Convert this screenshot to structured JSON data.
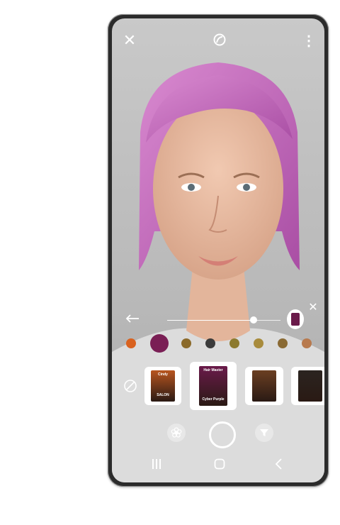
{
  "top_bar": {
    "close_icon": "close-icon",
    "logo_icon": "brand-logo-icon",
    "more_icon": "more-vertical-icon"
  },
  "slider": {
    "intensity": 0.76,
    "back_icon": "arrow-left-icon",
    "reset_icon": "close-icon"
  },
  "swatches": {
    "colors": [
      "#d9621f",
      "#7a1f55",
      "#8b6a2a",
      "#3b3b3b",
      "#8c7a2e",
      "#a88b3c",
      "#8a6a34",
      "#b87a4e"
    ],
    "selected_index": 1
  },
  "products": [
    {
      "name": "Cindy Salon",
      "brand_line": "Cindy",
      "title_line": "SALON",
      "color": "#b8551f"
    },
    {
      "name": "Hair Master",
      "brand_line": "Hair Master",
      "title_line": "Cyber Purple",
      "color": "#6a1a4a"
    },
    {
      "name": "Brown Shade",
      "brand_line": "",
      "title_line": "",
      "color": "#6b3f22"
    },
    {
      "name": "Dark Shade",
      "brand_line": "",
      "title_line": "",
      "color": "#2b2420"
    }
  ],
  "bottom_controls": {
    "left_icon": "flower-icon",
    "right_icon": "filter-icon",
    "shutter_icon": "shutter-button"
  },
  "nav": {
    "recents_icon": "recent-apps-icon",
    "home_icon": "home-icon",
    "back_icon": "back-chevron-icon"
  }
}
